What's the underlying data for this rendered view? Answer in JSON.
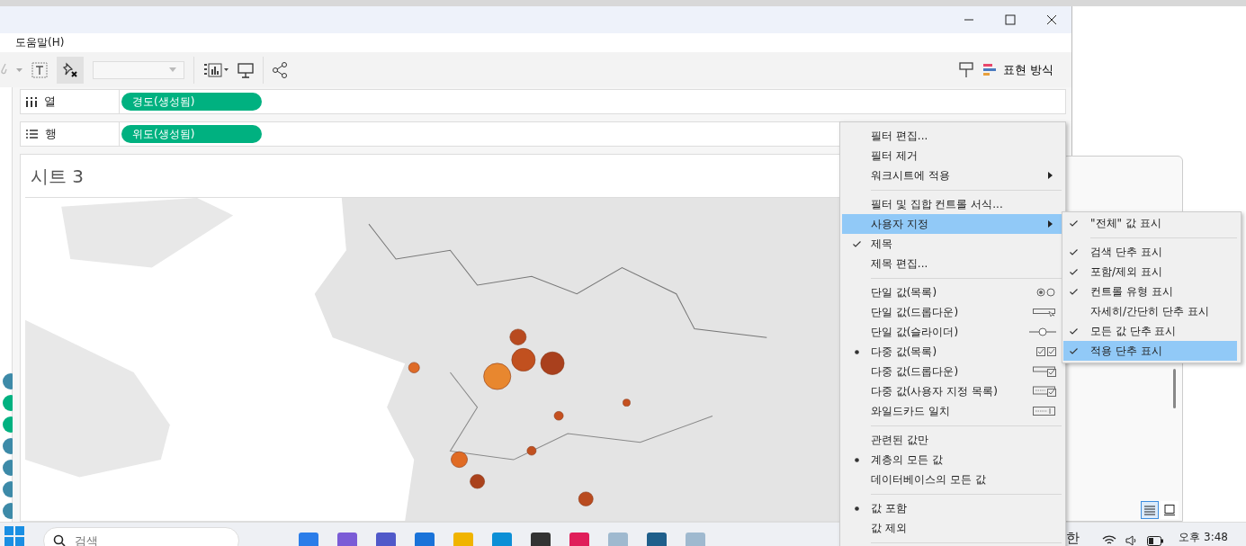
{
  "menu_bar": {
    "items": [
      "도움말(H)"
    ]
  },
  "toolbar": {
    "show_me": "표현 방식"
  },
  "shelves": [
    {
      "kind": "columns",
      "label": "열",
      "pill": "경도(생성됨)"
    },
    {
      "kind": "rows",
      "label": "행",
      "pill": "위도(생성됨)"
    }
  ],
  "sheet": {
    "title": "시트 3"
  },
  "context_menu": {
    "groups": [
      {
        "items": [
          {
            "label": "필터 편집...",
            "kind": "plain",
            "selected": false,
            "submenu": false
          },
          {
            "label": "필터 제거",
            "kind": "plain",
            "selected": false,
            "submenu": false
          },
          {
            "label": "워크시트에 적용",
            "kind": "plain",
            "selected": false,
            "submenu": true
          }
        ]
      },
      {
        "kind": "check",
        "items": [
          {
            "label": "필터 및 집합 컨트롤 서식...",
            "kind": "plain",
            "checked": false,
            "selected": false,
            "submenu": false
          },
          {
            "label": "사용자 지정",
            "kind": "plain",
            "checked": false,
            "selected": true,
            "submenu": true
          },
          {
            "label": "제목",
            "kind": "plain",
            "checked": true,
            "selected": false,
            "submenu": false
          },
          {
            "label": "제목 편집...",
            "kind": "plain",
            "checked": false,
            "selected": false,
            "submenu": false
          }
        ]
      },
      {
        "kind": "bullet",
        "items": [
          {
            "label": "단일 값(목록)",
            "kind": "radio-list",
            "checked": false,
            "selected": false,
            "submenu": false
          },
          {
            "label": "단일 값(드롭다운)",
            "kind": "dropdown",
            "checked": false,
            "selected": false,
            "submenu": false
          },
          {
            "label": "단일 값(슬라이더)",
            "kind": "slider",
            "checked": false,
            "selected": false,
            "submenu": false
          },
          {
            "label": "다중 값(목록)",
            "kind": "check-list",
            "checked": true,
            "selected": false,
            "submenu": false
          },
          {
            "label": "다중 값(드롭다운)",
            "kind": "check-dropdown",
            "checked": false,
            "selected": false,
            "submenu": false
          },
          {
            "label": "다중 값(사용자 지정 목록)",
            "kind": "custom-list",
            "checked": false,
            "selected": false,
            "submenu": false
          },
          {
            "label": "와일드카드 일치",
            "kind": "wildcard",
            "checked": false,
            "selected": false,
            "submenu": false
          }
        ]
      },
      {
        "kind": "bullet",
        "items": [
          {
            "label": "관련된 값만",
            "kind": "plain",
            "checked": false,
            "selected": false,
            "submenu": false
          },
          {
            "label": "계층의 모든 값",
            "kind": "plain",
            "checked": true,
            "selected": false,
            "submenu": false
          },
          {
            "label": "데이터베이스의 모든 값",
            "kind": "plain",
            "checked": false,
            "selected": false,
            "submenu": false
          }
        ]
      },
      {
        "kind": "bullet",
        "items": [
          {
            "label": "값 포함",
            "kind": "plain",
            "checked": true,
            "selected": false,
            "submenu": false
          },
          {
            "label": "값 제외",
            "kind": "plain",
            "checked": false,
            "selected": false,
            "submenu": false
          }
        ]
      }
    ]
  },
  "submenu": {
    "groups": [
      [
        {
          "label": "\"전체\" 값 표시",
          "checked": true,
          "selected": false
        }
      ],
      [
        {
          "label": "검색 단추 표시",
          "checked": true,
          "selected": false
        },
        {
          "label": "포함/제외 표시",
          "checked": true,
          "selected": false
        },
        {
          "label": "컨트롤 유형 표시",
          "checked": true,
          "selected": false
        },
        {
          "label": "자세히/간단히 단추 표시",
          "checked": false,
          "selected": false
        },
        {
          "label": "모든 값 단추 표시",
          "checked": true,
          "selected": false
        },
        {
          "label": "적용 단추 표시",
          "checked": true,
          "selected": true
        }
      ]
    ]
  },
  "taskbar": {
    "search": {
      "placeholder": "검색"
    },
    "ime": "한",
    "time": "오후 3:48"
  }
}
